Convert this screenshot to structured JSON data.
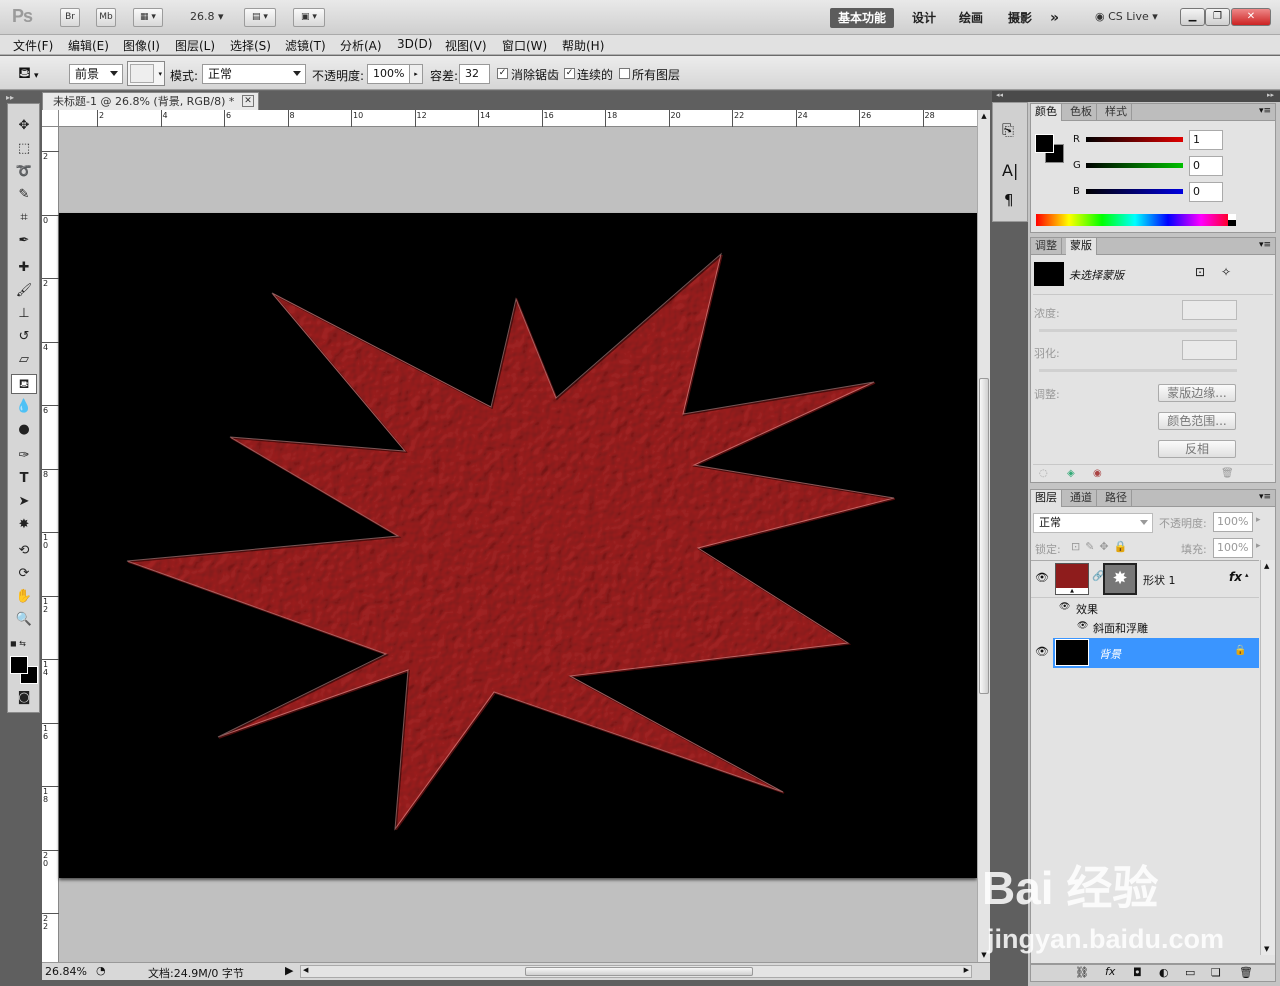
{
  "app": {
    "logo": "Ps",
    "br": "Br",
    "mb": "Mb",
    "zoom_menu": "26.8"
  },
  "workspaces": {
    "active": "基本功能",
    "items": [
      "设计",
      "绘画",
      "摄影"
    ],
    "more": "»",
    "cslive": "CS Live"
  },
  "menus": [
    "文件(F)",
    "编辑(E)",
    "图像(I)",
    "图层(L)",
    "选择(S)",
    "滤镜(T)",
    "分析(A)",
    "3D(D)",
    "视图(V)",
    "窗口(W)",
    "帮助(H)"
  ],
  "options": {
    "fill_source": "前景",
    "mode_label": "模式:",
    "mode_value": "正常",
    "opacity_label": "不透明度:",
    "opacity_value": "100%",
    "tolerance_label": "容差:",
    "tolerance_value": "32",
    "antialias_label": "消除锯齿",
    "contiguous_label": "连续的",
    "all_layers_label": "所有图层"
  },
  "document": {
    "tab_title": "未标题-1 @ 26.8% (背景, RGB/8) *",
    "h_ruler": [
      "2",
      "4",
      "6",
      "8",
      "10",
      "12",
      "14",
      "16",
      "18",
      "20",
      "22",
      "24",
      "26",
      "28"
    ],
    "v_ruler": [
      "2",
      "0",
      "2",
      "4",
      "6",
      "8",
      "1 0",
      "1 2",
      "1 4",
      "1 6",
      "1 8",
      "2 0",
      "2 2"
    ],
    "star_color": "#8e1c1c"
  },
  "status": {
    "zoom": "26.84%",
    "doc": "文档:24.9M/0 字节"
  },
  "color_panel": {
    "tabs": [
      "颜色",
      "色板",
      "样式"
    ],
    "channels": [
      {
        "label": "R",
        "value": "1",
        "color": "#e00000"
      },
      {
        "label": "G",
        "value": "0",
        "color": "#00b000"
      },
      {
        "label": "B",
        "value": "0",
        "color": "#0000e0"
      }
    ]
  },
  "masks_panel": {
    "tabs": [
      "调整",
      "蒙版"
    ],
    "title": "未选择蒙版",
    "density_label": "浓度:",
    "feather_label": "羽化:",
    "refine_label": "调整:",
    "buttons": [
      "蒙版边缘...",
      "颜色范围...",
      "反相"
    ]
  },
  "layers_panel": {
    "tabs": [
      "图层",
      "通道",
      "路径"
    ],
    "blend_mode": "正常",
    "opacity_label": "不透明度:",
    "opacity_value": "100%",
    "lock_label": "锁定:",
    "fill_label": "填充:",
    "fill_value": "100%",
    "layers": [
      {
        "name": "形状 1",
        "fx": "fx",
        "effects_label": "效果",
        "effect": "斜面和浮雕"
      },
      {
        "name": "背景"
      }
    ]
  },
  "watermark": {
    "line1": "Bai 经验",
    "line2": "jingyan.baidu.com"
  }
}
